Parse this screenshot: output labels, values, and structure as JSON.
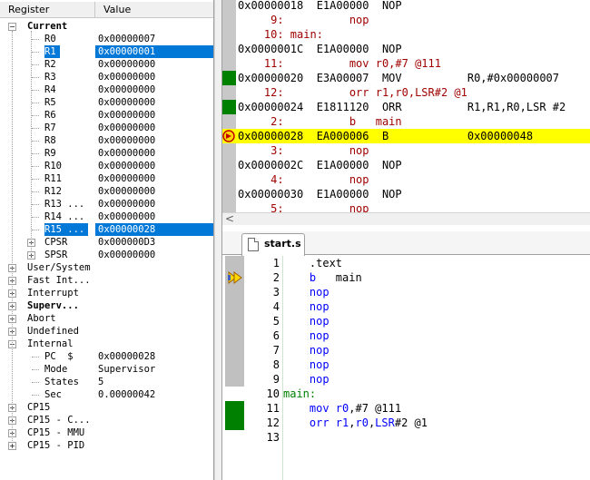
{
  "registers": {
    "col_register": "Register",
    "col_value": "Value",
    "current_label": "Current",
    "current_regs": [
      {
        "name": "R0",
        "value": "0x00000007"
      },
      {
        "name": "R1",
        "value": "0x00000001"
      },
      {
        "name": "R2",
        "value": "0x00000000"
      },
      {
        "name": "R3",
        "value": "0x00000000"
      },
      {
        "name": "R4",
        "value": "0x00000000"
      },
      {
        "name": "R5",
        "value": "0x00000000"
      },
      {
        "name": "R6",
        "value": "0x00000000"
      },
      {
        "name": "R7",
        "value": "0x00000000"
      },
      {
        "name": "R8",
        "value": "0x00000000"
      },
      {
        "name": "R9",
        "value": "0x00000000"
      },
      {
        "name": "R10",
        "value": "0x00000000"
      },
      {
        "name": "R11",
        "value": "0x00000000"
      },
      {
        "name": "R12",
        "value": "0x00000000"
      },
      {
        "name": "R13 ...",
        "value": "0x00000000"
      },
      {
        "name": "R14 ...",
        "value": "0x00000000"
      },
      {
        "name": "R15 ...",
        "value": "0x00000028"
      }
    ],
    "cpsr": {
      "name": "CPSR",
      "value": "0x000000D3"
    },
    "spsr": {
      "name": "SPSR",
      "value": "0x00000000"
    },
    "modes": [
      "User/System",
      "Fast Int...",
      "Interrupt",
      "Superv...",
      "Abort",
      "Undefined"
    ],
    "internal_label": "Internal",
    "internal": [
      {
        "name": "PC  $",
        "value": "0x00000028"
      },
      {
        "name": "Mode",
        "value": "Supervisor"
      },
      {
        "name": "States",
        "value": "5"
      },
      {
        "name": "Sec",
        "value": "0.00000042"
      }
    ],
    "cp15": [
      "CP15",
      "CP15 - C...",
      "CP15 - MMU",
      "CP15 - PID"
    ]
  },
  "disassembly": [
    {
      "kind": "asm",
      "text": "0x00000018  E1A00000  NOP"
    },
    {
      "kind": "src",
      "text": "     9:          nop"
    },
    {
      "kind": "src",
      "text": "    10: main:"
    },
    {
      "kind": "asm",
      "text": "0x0000001C  E1A00000  NOP"
    },
    {
      "kind": "src",
      "text": "    11:          mov r0,#7 @111"
    },
    {
      "kind": "asm",
      "text": "0x00000020  E3A00007  MOV          R0,#0x00000007",
      "mark": "green"
    },
    {
      "kind": "src",
      "text": "    12:          orr r1,r0,LSR#2 @1"
    },
    {
      "kind": "asm",
      "text": "0x00000024  E1811120  ORR          R1,R1,R0,LSR #2",
      "mark": "green"
    },
    {
      "kind": "src",
      "text": "     2:          b   main"
    },
    {
      "kind": "asm",
      "text": "0x00000028  EA000006  B            0x00000048",
      "mark": "arrow",
      "current": true
    },
    {
      "kind": "src",
      "text": "     3:          nop"
    },
    {
      "kind": "asm",
      "text": "0x0000002C  E1A00000  NOP"
    },
    {
      "kind": "src",
      "text": "     4:          nop"
    },
    {
      "kind": "asm",
      "text": "0x00000030  E1A00000  NOP"
    },
    {
      "kind": "src",
      "text": "     5:          nop"
    }
  ],
  "editor": {
    "tab_label": "start.s",
    "lines": [
      {
        "num": "1",
        "parts": [
          {
            "t": "    .text",
            "c": "plain"
          }
        ]
      },
      {
        "num": "2",
        "parts": [
          {
            "t": "    b",
            "c": "kw"
          },
          {
            "t": "   main",
            "c": "plain"
          }
        ]
      },
      {
        "num": "3",
        "parts": [
          {
            "t": "    nop",
            "c": "kw"
          }
        ]
      },
      {
        "num": "4",
        "parts": [
          {
            "t": "    nop",
            "c": "kw"
          }
        ]
      },
      {
        "num": "5",
        "parts": [
          {
            "t": "    nop",
            "c": "kw"
          }
        ]
      },
      {
        "num": "6",
        "parts": [
          {
            "t": "    nop",
            "c": "kw"
          }
        ]
      },
      {
        "num": "7",
        "parts": [
          {
            "t": "    nop",
            "c": "kw"
          }
        ]
      },
      {
        "num": "8",
        "parts": [
          {
            "t": "    nop",
            "c": "kw"
          }
        ]
      },
      {
        "num": "9",
        "parts": [
          {
            "t": "    nop",
            "c": "kw"
          }
        ]
      },
      {
        "num": "10",
        "parts": [
          {
            "t": "main:",
            "c": "lbl"
          }
        ]
      },
      {
        "num": "11",
        "parts": [
          {
            "t": "    mov ",
            "c": "kw"
          },
          {
            "t": "r0",
            "c": "reg"
          },
          {
            "t": ",#7 @111",
            "c": "plain"
          }
        ]
      },
      {
        "num": "12",
        "parts": [
          {
            "t": "    orr ",
            "c": "kw"
          },
          {
            "t": "r1",
            "c": "reg"
          },
          {
            "t": ",",
            "c": "plain"
          },
          {
            "t": "r0",
            "c": "reg"
          },
          {
            "t": ",",
            "c": "plain"
          },
          {
            "t": "LSR",
            "c": "reg"
          },
          {
            "t": "#2 @1",
            "c": "plain"
          }
        ]
      },
      {
        "num": "13",
        "parts": []
      }
    ]
  },
  "colors": {
    "selection": "#0078d7",
    "current_line": "#ffff00",
    "coverage_green": "#008000",
    "source_text": "#a00000"
  }
}
